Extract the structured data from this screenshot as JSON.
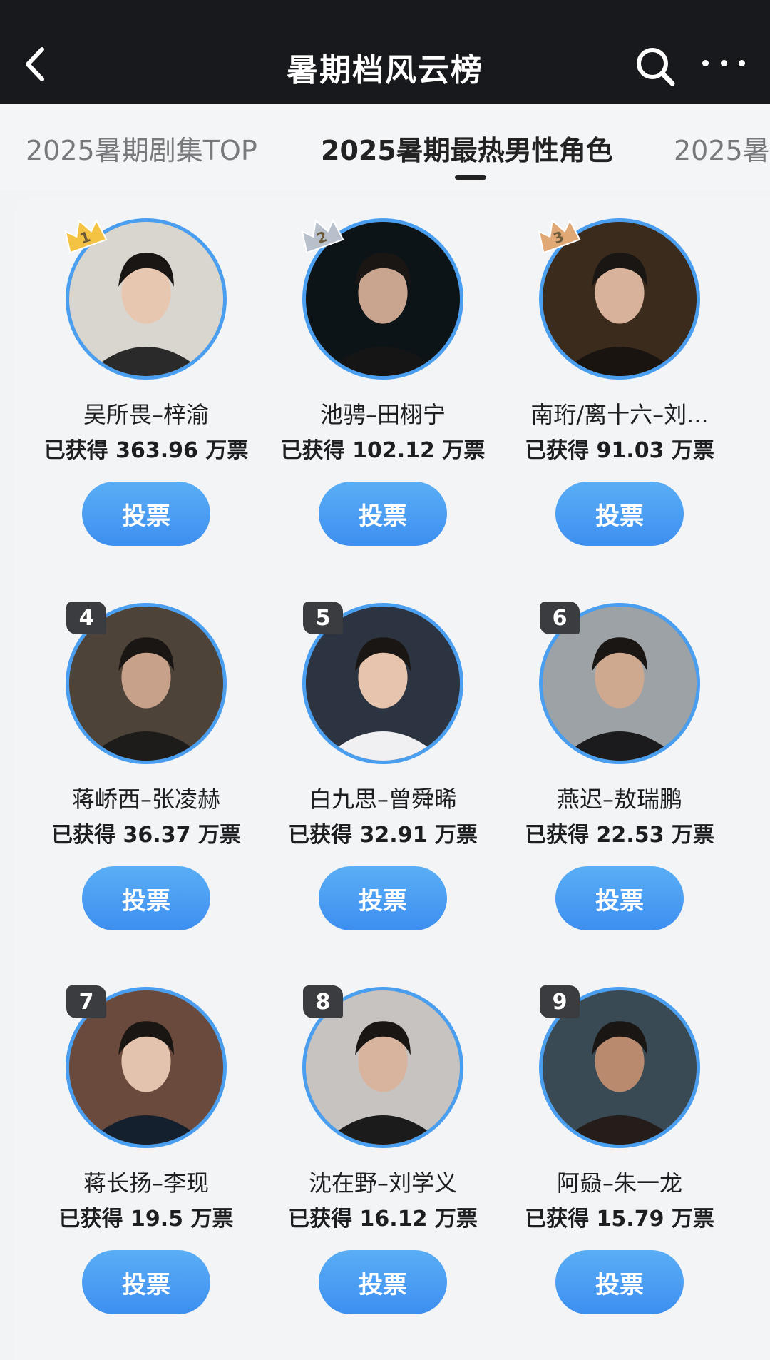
{
  "header": {
    "title": "暑期档风云榜",
    "back_icon": "chevron-left-icon",
    "search_icon": "search-icon",
    "more_icon": "more-dots-icon"
  },
  "tabs": [
    {
      "label": "2025暑期剧集TOP",
      "active": false
    },
    {
      "label": "2025暑期最热男性角色",
      "active": true
    },
    {
      "label": "2025暑",
      "active": false
    }
  ],
  "colors": {
    "accent": "#3d8ff0",
    "ring": "#4a9ef0",
    "gold": "#f5c343",
    "silver": "#b8c0cc",
    "bronze": "#e0a875"
  },
  "vote_button_label": "投票",
  "ranking": [
    {
      "rank": "1",
      "name": "吴所畏–梓渝",
      "votes_text": "已获得 363.96 万票"
    },
    {
      "rank": "2",
      "name": "池骋–田栩宁",
      "votes_text": "已获得 102.12 万票"
    },
    {
      "rank": "3",
      "name": "南珩/离十六–刘...",
      "votes_text": "已获得 91.03 万票"
    },
    {
      "rank": "4",
      "name": "蒋峤西–张凌赫",
      "votes_text": "已获得 36.37 万票"
    },
    {
      "rank": "5",
      "name": "白九思–曾舜晞",
      "votes_text": "已获得 32.91 万票"
    },
    {
      "rank": "6",
      "name": "燕迟–敖瑞鹏",
      "votes_text": "已获得 22.53 万票"
    },
    {
      "rank": "7",
      "name": "蒋长扬–李现",
      "votes_text": "已获得 19.5 万票"
    },
    {
      "rank": "8",
      "name": "沈在野–刘学义",
      "votes_text": "已获得 16.12 万票"
    },
    {
      "rank": "9",
      "name": "阿赑–朱一龙",
      "votes_text": "已获得 15.79 万票"
    }
  ]
}
